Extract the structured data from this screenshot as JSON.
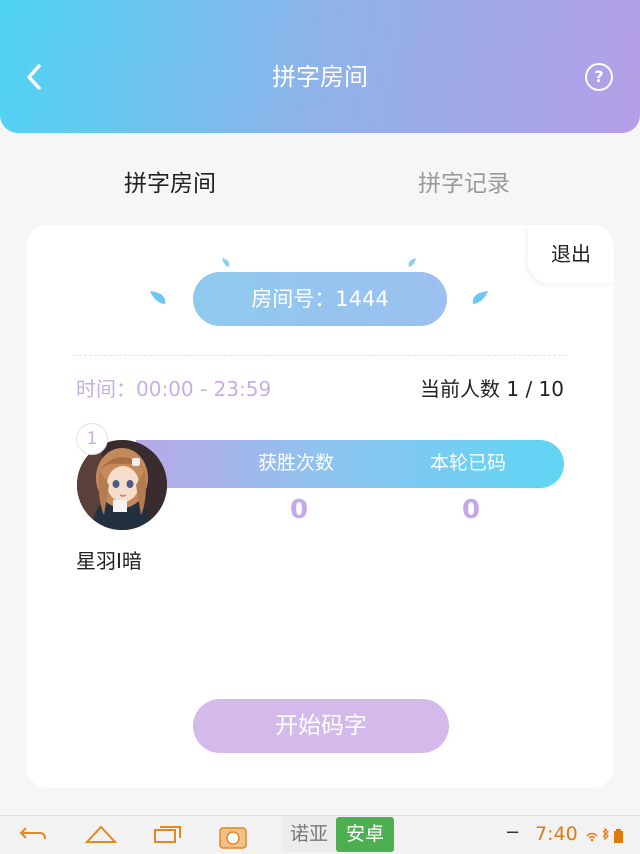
{
  "header": {
    "title": "拼字房间",
    "back_icon": "chevron-left-icon",
    "help_icon": "question-circle-icon",
    "help_symbol": "?"
  },
  "tabs": [
    {
      "label": "拼字房间",
      "active": true
    },
    {
      "label": "拼字记录",
      "active": false
    }
  ],
  "room": {
    "exit_label": "退出",
    "room_number_label": "房间号：1444",
    "time_label": "时间：00:00 - 23:59",
    "current_count_label": "当前人数 1 / 10"
  },
  "players": [
    {
      "rank": "1",
      "name": "星羽I暗",
      "wins_label": "获胜次数",
      "wins_value": "0",
      "typed_label": "本轮已码",
      "typed_value": "0"
    }
  ],
  "actions": {
    "start_label": "开始码字"
  },
  "system_bar": {
    "brand_left": "诺亚",
    "brand_right": "安卓",
    "dash": "−",
    "time": "7:40"
  },
  "colors": {
    "header_gradient_start": "#4fd4f3",
    "header_gradient_end": "#b59ee7",
    "accent_purple": "#c4a9ea",
    "start_button": "#d3baea",
    "android_green": "#4caf50",
    "clock_orange": "#e07a10"
  }
}
